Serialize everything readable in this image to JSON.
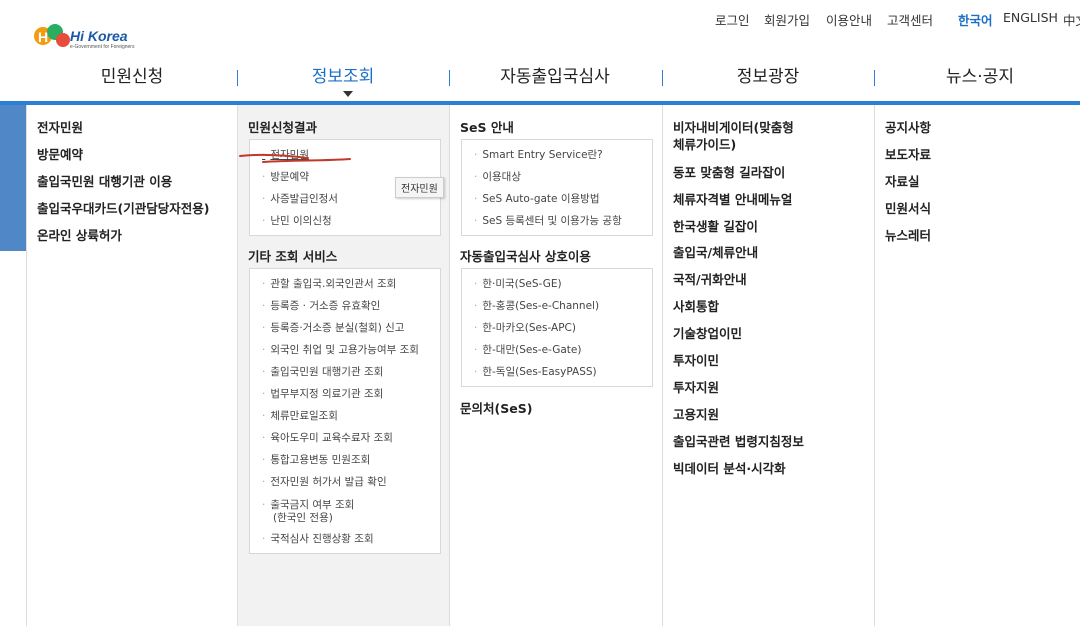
{
  "logo": {
    "brand": "Hi Korea",
    "tagline": "e-Government for Foreigners"
  },
  "utility": {
    "login": "로그인",
    "signup": "회원가입",
    "guide": "이용안내",
    "support": "고객센터",
    "lang_ko": "한국어",
    "lang_en": "ENGLISH",
    "lang_zh": "中文"
  },
  "gnb": [
    "민원신청",
    "정보조회",
    "자동출입국심사",
    "정보광장",
    "뉴스·공지"
  ],
  "col1": [
    "전자민원",
    "방문예약",
    "출입국민원 대행기관 이용",
    "출입국우대카드(기관담당자전용)",
    "온라인 상륙허가"
  ],
  "col2": {
    "sec1_title": "민원신청결과",
    "sec1_items": [
      "전자민원",
      "방문예약",
      "사증발급인정서",
      "난민 이의신청"
    ],
    "sec2_title": "기타 조회 서비스",
    "sec2_items": [
      "관할 출입국.외국인관서 조회",
      "등록증 · 거소증 유효확인",
      "등록증·거소증 분실(철회) 신고",
      "외국인 취업 및 고용가능여부 조회",
      "출입국민원 대행기관 조회",
      "법무부지정 의료기관 조회",
      "체류만료일조회",
      "육아도우미 교육수료자 조회",
      "통합고용변동 민원조회",
      "전자민원 허가서 발급 확인",
      "출국금지 여부 조회",
      "(한국인 전용)",
      "국적심사 진행상황 조회"
    ]
  },
  "tooltip": "전자민원",
  "col3": {
    "sec1_title": "SeS 안내",
    "sec1_items": [
      "Smart Entry Service란?",
      "이용대상",
      "SeS Auto-gate 이용방법",
      "SeS 등록센터 및 이용가능 공항"
    ],
    "sec2_title": "자동출입국심사 상호이용",
    "sec2_items": [
      "한·미국(SeS-GE)",
      "한-홍콩(Ses-e-Channel)",
      "한-마카오(Ses-APC)",
      "한-대만(Ses-e-Gate)",
      "한-독일(Ses-EasyPASS)"
    ],
    "sec3_title": "문의처(SeS)"
  },
  "col4": [
    "비자내비게이터(맞춤형",
    "체류가이드)",
    "동포 맞춤형 길라잡이",
    "체류자격별 안내메뉴얼",
    "한국생활 길잡이",
    "출입국/체류안내",
    "국적/귀화안내",
    "사회통합",
    "기술창업이민",
    "투자이민",
    "투자지원",
    "고용지원",
    "출입국관련 법령지침정보",
    "빅데이터 분석·시각화"
  ],
  "col5": [
    "공지사항",
    "보도자료",
    "자료실",
    "민원서식",
    "뉴스레터"
  ],
  "colors": {
    "accent": "#1b6fc8",
    "nav_line": "#2b7fd4",
    "left_tab": "#4f87c7",
    "scribble": "#c0392b"
  }
}
